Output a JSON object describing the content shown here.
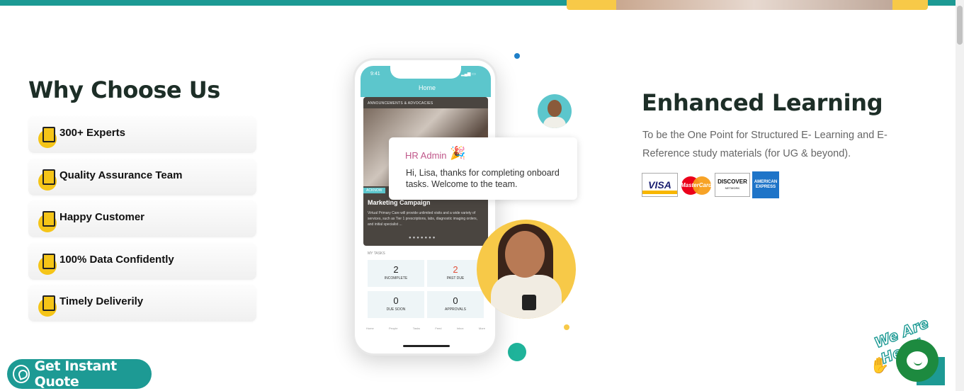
{
  "why": {
    "title": "Why Choose Us",
    "items": [
      {
        "label": "300+ Experts",
        "icon": "graduation-cap-icon"
      },
      {
        "label": "Quality Assurance Team",
        "icon": "handshake-icon"
      },
      {
        "label": "Happy Customer",
        "icon": "chart-icon"
      },
      {
        "label": "100% Data Confidently",
        "icon": "document-icon"
      },
      {
        "label": "Timely Deliverily",
        "icon": "calendar-icon"
      }
    ]
  },
  "phone": {
    "time": "9:41",
    "header": "Home",
    "section": "ANNOUNCEMENTS & ADVOCACIES",
    "card_title": "Marketing Campaign",
    "card_desc": "Virtual Primary Care will provide unlimited visits and a wide variety of services, such as Tier 1 prescriptions, labs, diagnostic imaging orders, and initial specialist ...",
    "ack": "ACKNOW",
    "tasks_label": "MY TASKS",
    "tasks": [
      {
        "count": "2",
        "label": "INCOMPLETE"
      },
      {
        "count": "2",
        "label": "PAST DUE"
      },
      {
        "count": "0",
        "label": "DUE SOON"
      },
      {
        "count": "0",
        "label": "APPROVALS"
      }
    ],
    "tabbar": [
      "Home",
      "People",
      "Tasks",
      "Feed",
      "Inbox",
      "More"
    ]
  },
  "chat_bubble": {
    "sender": "HR Admin",
    "message": "Hi, Lisa, thanks for completing onboard tasks. Welcome to the team."
  },
  "enhanced": {
    "title": "Enhanced Learning",
    "text": "To be the One Point for Structured E- Learning and E-Reference study materials (for UG & beyond).",
    "cards": {
      "visa": "VISA",
      "mastercard": "MasterCard",
      "discover": "DISCOVER",
      "discover_sub": "NETWORK",
      "amex_line1": "AMERICAN",
      "amex_line2": "EXPRESS"
    }
  },
  "quote_button": "Get Instant Quote",
  "we_are_here": "We Are Here!",
  "colors": {
    "teal": "#1d9a94",
    "yellow": "#f5c518",
    "heading": "#1d2e27",
    "chat_green": "#1d8a3f"
  }
}
